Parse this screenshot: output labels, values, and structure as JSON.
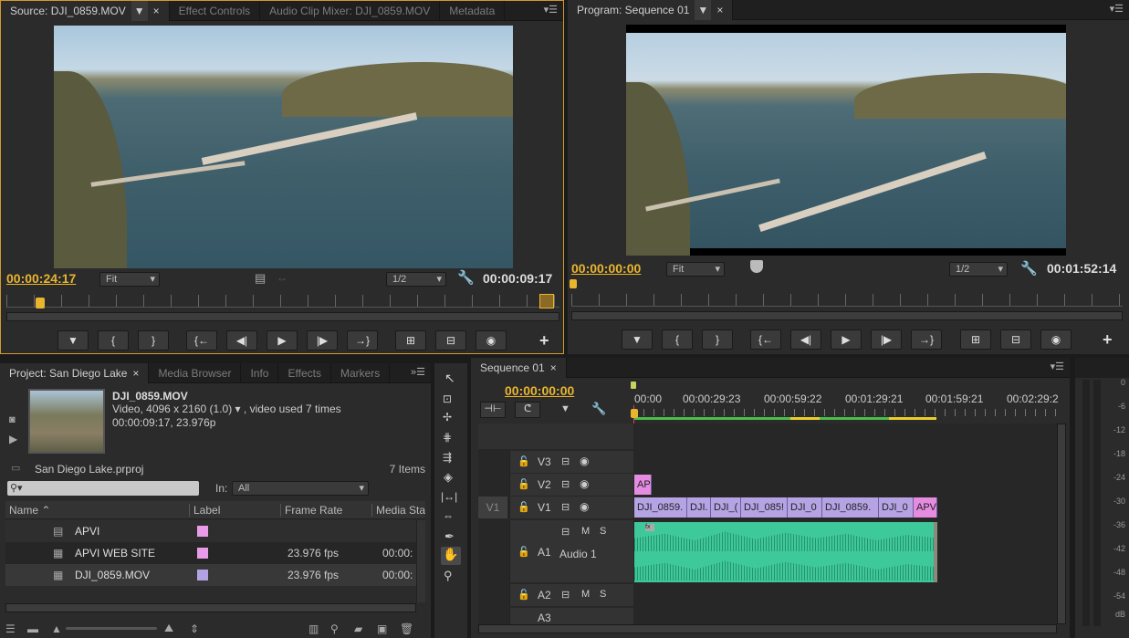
{
  "source": {
    "tabs": [
      "Source: DJI_0859.MOV",
      "Effect Controls",
      "Audio Clip Mixer: DJI_0859.MOV",
      "Metadata"
    ],
    "timecode_left": "00:00:24:17",
    "fit": "Fit",
    "resolution": "1/2",
    "timecode_right": "00:00:09:17"
  },
  "program": {
    "tab": "Program: Sequence 01",
    "timecode_left": "00:00:00:00",
    "fit": "Fit",
    "resolution": "1/2",
    "timecode_right": "00:01:52:14"
  },
  "transport_glyphs": [
    "▼",
    "{",
    "}",
    "{←",
    "◀|",
    "▶",
    "|▶",
    "→}",
    "⊞",
    "⊟",
    "◉"
  ],
  "project": {
    "tabs": [
      "Project: San Diego Lake",
      "Media Browser",
      "Info",
      "Effects",
      "Markers"
    ],
    "clip_name": "DJI_0859.MOV",
    "clip_info1": "Video, 4096 x 2160 (1.0) ▾ , video used 7 times",
    "clip_info2": "00:00:09:17, 23.976p",
    "project_file": "San Diego Lake.prproj",
    "items_count": "7 Items",
    "in_label": "In:",
    "in_value": "All",
    "columns": [
      "Name",
      "Label",
      "Frame Rate",
      "Media Sta"
    ],
    "rows": [
      {
        "name": "APVI",
        "color": "#e99be8",
        "rate": "",
        "media": ""
      },
      {
        "name": "APVI WEB SITE",
        "color": "#e99be8",
        "rate": "23.976 fps",
        "media": "00:00:"
      },
      {
        "name": "DJI_0859.MOV",
        "color": "#b3a3e4",
        "rate": "23.976 fps",
        "media": "00:00:"
      }
    ]
  },
  "timeline": {
    "tab": "Sequence 01",
    "timecode": "00:00:00:00",
    "ruler": [
      "00:00",
      "00:00:29:23",
      "00:00:59:22",
      "00:01:29:21",
      "00:01:59:21",
      "00:02:29:2"
    ],
    "tracks": {
      "v3": "V3",
      "v2": "V2",
      "v1": "V1",
      "v1_src": "V1",
      "a1": "A1",
      "a1_name": "Audio 1",
      "a2": "A2",
      "a3": "A3"
    },
    "v2_clip": "AP",
    "v1_clips": [
      "DJI_0859.",
      "DJI.",
      "DJI_(",
      "DJI_085!",
      "DJI_0",
      "DJI_0859.",
      "DJI_0",
      "APV"
    ],
    "ms": [
      "M",
      "S"
    ]
  },
  "meter_ticks": [
    "0",
    "-6",
    "-12",
    "-18",
    "-24",
    "-30",
    "-36",
    "-42",
    "-48",
    "-54",
    "dB"
  ],
  "colors": {
    "timecode": "#e9b52e",
    "clip_video": "#b6a3e4",
    "clip_pink": "#e58be0",
    "audio": "#3ec99a",
    "playhead": "#e04040"
  }
}
